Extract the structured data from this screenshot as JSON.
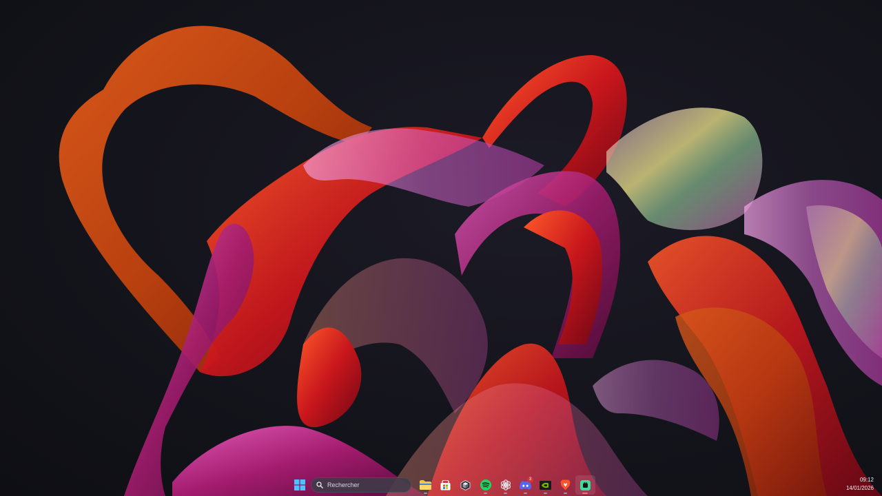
{
  "desktop": {
    "wallpaper": "abstract-ribbon-bloom"
  },
  "taskbar": {
    "search": {
      "label": "Rechercher",
      "icon": "search-icon"
    },
    "apps": [
      {
        "name": "file-explorer",
        "icon": "folder-icon",
        "color": "#f4c542"
      },
      {
        "name": "microsoft-store",
        "icon": "store-icon",
        "color": "#ffffff"
      },
      {
        "name": "app-cube",
        "icon": "cube-icon",
        "color": "#cfcfd6"
      },
      {
        "name": "spotify",
        "icon": "spotify-icon",
        "color": "#1ed760"
      },
      {
        "name": "chatgpt",
        "icon": "chatgpt-icon",
        "color": "#e8e8ec"
      },
      {
        "name": "discord",
        "icon": "discord-icon",
        "color": "#5865f2",
        "badge": "3"
      },
      {
        "name": "nvidia",
        "icon": "nvidia-icon",
        "color": "#76b900"
      },
      {
        "name": "brave",
        "icon": "brave-icon",
        "color": "#fb542b"
      },
      {
        "name": "active-app",
        "icon": "app-icon",
        "color": "#3ddc97"
      }
    ],
    "clock": {
      "time": "09:12",
      "date": "14/01/2026"
    }
  }
}
